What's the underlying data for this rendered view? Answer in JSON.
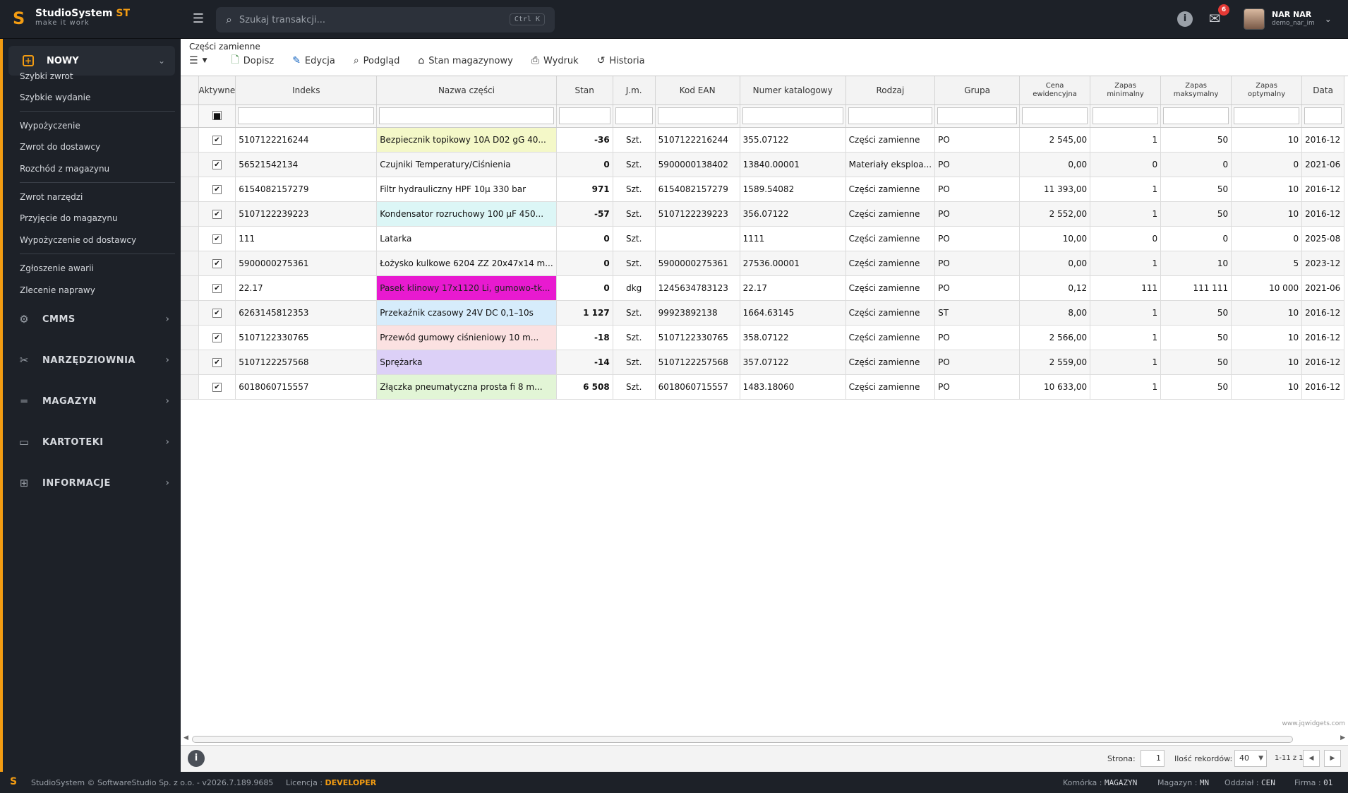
{
  "app": {
    "name": "StudioSystem",
    "name_suffix": "ST",
    "tagline": "make it work"
  },
  "topbar": {
    "search_placeholder": "Szukaj transakcji...",
    "search_shortcut": "Ctrl K",
    "mail_badge": "6",
    "user_name": "NAR NAR",
    "user_login": "demo_nar_im"
  },
  "sidebar": {
    "nowy_label": "NOWY",
    "items": [
      {
        "label": "Szybki zwrot"
      },
      {
        "label": "Szybkie wydanie"
      },
      {
        "label": "Wypożyczenie"
      },
      {
        "label": "Zwrot do dostawcy"
      },
      {
        "label": "Rozchód z magazynu"
      },
      {
        "label": "Zwrot narzędzi"
      },
      {
        "label": "Przyjęcie do magazynu"
      },
      {
        "label": "Wypożyczenie od dostawcy"
      },
      {
        "label": "Zgłoszenie awarii"
      },
      {
        "label": "Zlecenie naprawy"
      }
    ],
    "sections": [
      {
        "label": "CMMS",
        "icon": "gears-icon"
      },
      {
        "label": "NARZĘDZIOWNIA",
        "icon": "tools-icon"
      },
      {
        "label": "MAGAZYN",
        "icon": "shelf-icon"
      },
      {
        "label": "KARTOTEKI",
        "icon": "folder-icon"
      },
      {
        "label": "INFORMACJE",
        "icon": "sitemap-icon"
      }
    ]
  },
  "page": {
    "breadcrumb": "Części zamienne"
  },
  "toolbar": {
    "dopisz": "Dopisz",
    "edycja": "Edycja",
    "podglad": "Podgląd",
    "stan": "Stan magazynowy",
    "wydruk": "Wydruk",
    "historia": "Historia"
  },
  "grid": {
    "columns": {
      "aktywne": "Aktywne",
      "indeks": "Indeks",
      "nazwa": "Nazwa części",
      "stan": "Stan",
      "jm": "J.m.",
      "ean": "Kod EAN",
      "katalog": "Numer katalogowy",
      "rodzaj": "Rodzaj",
      "grupa": "Grupa",
      "cena_1": "Cena",
      "cena_2": "ewidencyjna",
      "zmin_1": "Zapas",
      "zmin_2": "minimalny",
      "zmax_1": "Zapas",
      "zmax_2": "maksymalny",
      "zopt_1": "Zapas",
      "zopt_2": "optymalny",
      "data": "Data"
    },
    "rows": [
      {
        "indeks": "5107122216244",
        "nazwa": "Bezpiecznik topikowy 10A D02 gG 40...",
        "bg": "#f4f8c8",
        "fg": "#111",
        "stan": "-36",
        "jm": "Szt.",
        "ean": "5107122216244",
        "katalog": "355.07122",
        "rodzaj": "Części zamienne",
        "grupa": "PO",
        "cena": "2 545,00",
        "zmin": "1",
        "zmax": "50",
        "zopt": "10",
        "data": "2016-12"
      },
      {
        "indeks": "56521542134",
        "nazwa": "Czujniki Temperatury/Ciśnienia",
        "bg": "",
        "fg": "#111",
        "stan": "0",
        "jm": "Szt.",
        "ean": "5900000138402",
        "katalog": "13840.00001",
        "rodzaj": "Materiały eksploa...",
        "grupa": "PO",
        "cena": "0,00",
        "zmin": "0",
        "zmax": "0",
        "zopt": "0",
        "data": "2021-06"
      },
      {
        "indeks": "6154082157279",
        "nazwa": "Filtr hydrauliczny HPF 10µ 330 bar",
        "bg": "",
        "fg": "#111",
        "stan": "971",
        "jm": "Szt.",
        "ean": "6154082157279",
        "katalog": "1589.54082",
        "rodzaj": "Części zamienne",
        "grupa": "PO",
        "cena": "11 393,00",
        "zmin": "1",
        "zmax": "50",
        "zopt": "10",
        "data": "2016-12"
      },
      {
        "indeks": "5107122239223",
        "nazwa": "Kondensator rozruchowy 100 µF 450...",
        "bg": "#dcf6f6",
        "fg": "#111",
        "stan": "-57",
        "jm": "Szt.",
        "ean": "5107122239223",
        "katalog": "356.07122",
        "rodzaj": "Części zamienne",
        "grupa": "PO",
        "cena": "2 552,00",
        "zmin": "1",
        "zmax": "50",
        "zopt": "10",
        "data": "2016-12"
      },
      {
        "indeks": "111",
        "nazwa": "Latarka",
        "bg": "",
        "fg": "#111",
        "stan": "0",
        "jm": "Szt.",
        "ean": "",
        "katalog": "1111",
        "rodzaj": "Części zamienne",
        "grupa": "PO",
        "cena": "10,00",
        "zmin": "0",
        "zmax": "0",
        "zopt": "0",
        "data": "2025-08"
      },
      {
        "indeks": "5900000275361",
        "nazwa": "Łożysko kulkowe 6204 ZZ 20x47x14 m...",
        "bg": "",
        "fg": "#111",
        "stan": "0",
        "jm": "Szt.",
        "ean": "5900000275361",
        "katalog": "27536.00001",
        "rodzaj": "Części zamienne",
        "grupa": "PO",
        "cena": "0,00",
        "zmin": "1",
        "zmax": "10",
        "zopt": "5",
        "data": "2023-12"
      },
      {
        "indeks": "22.17",
        "nazwa": "Pasek klinowy 17x1120 Li, gumowo-tk...",
        "bg": "#e81ad0",
        "fg": "#222",
        "stan": "0",
        "jm": "dkg",
        "ean": "1245634783123",
        "katalog": "22.17",
        "rodzaj": "Części zamienne",
        "grupa": "PO",
        "cena": "0,12",
        "zmin": "111",
        "zmax": "111 111",
        "zopt": "10 000",
        "data": "2021-06"
      },
      {
        "indeks": "6263145812353",
        "nazwa": "Przekaźnik czasowy 24V DC 0,1–10s",
        "bg": "#d6ecfb",
        "fg": "#111",
        "stan": "1 127",
        "jm": "Szt.",
        "ean": "99923892138",
        "katalog": "1664.63145",
        "rodzaj": "Części zamienne",
        "grupa": "ST",
        "cena": "8,00",
        "zmin": "1",
        "zmax": "50",
        "zopt": "10",
        "data": "2016-12"
      },
      {
        "indeks": "5107122330765",
        "nazwa": "Przewód gumowy ciśnieniowy 10 m...",
        "bg": "#fbe1e1",
        "fg": "#111",
        "stan": "-18",
        "jm": "Szt.",
        "ean": "5107122330765",
        "katalog": "358.07122",
        "rodzaj": "Części zamienne",
        "grupa": "PO",
        "cena": "2 566,00",
        "zmin": "1",
        "zmax": "50",
        "zopt": "10",
        "data": "2016-12"
      },
      {
        "indeks": "5107122257568",
        "nazwa": "Sprężarka",
        "bg": "#dcd0f7",
        "fg": "#111",
        "stan": "-14",
        "jm": "Szt.",
        "ean": "5107122257568",
        "katalog": "357.07122",
        "rodzaj": "Części zamienne",
        "grupa": "PO",
        "cena": "2 559,00",
        "zmin": "1",
        "zmax": "50",
        "zopt": "10",
        "data": "2016-12"
      },
      {
        "indeks": "6018060715557",
        "nazwa": "Złączka pneumatyczna prosta fi 8 m...",
        "bg": "#e2f5d6",
        "fg": "#111",
        "stan": "6 508",
        "jm": "Szt.",
        "ean": "6018060715557",
        "katalog": "1483.18060",
        "rodzaj": "Części zamienne",
        "grupa": "PO",
        "cena": "10 633,00",
        "zmin": "1",
        "zmax": "50",
        "zopt": "10",
        "data": "2016-12"
      }
    ]
  },
  "watermark": "www.jqwidgets.com",
  "pager": {
    "strona_label": "Strona:",
    "page": "1",
    "ilosc_label": "Ilość rekordów:",
    "per_page": "40",
    "range": "1-11 z 11"
  },
  "footer": {
    "copyright": "StudioSystem © SoftwareStudio Sp. z o.o. - v2026.7.189.9685",
    "licencja_label": "Licencja :",
    "licencja_value": "DEVELOPER",
    "komorka_label": "Komórka :",
    "komorka_value": "MAGAZYN",
    "magazyn_label": "Magazyn :",
    "magazyn_value": "MN",
    "oddzial_label": "Oddział :",
    "oddzial_value": "CEN",
    "firma_label": "Firma :",
    "firma_value": "01"
  }
}
